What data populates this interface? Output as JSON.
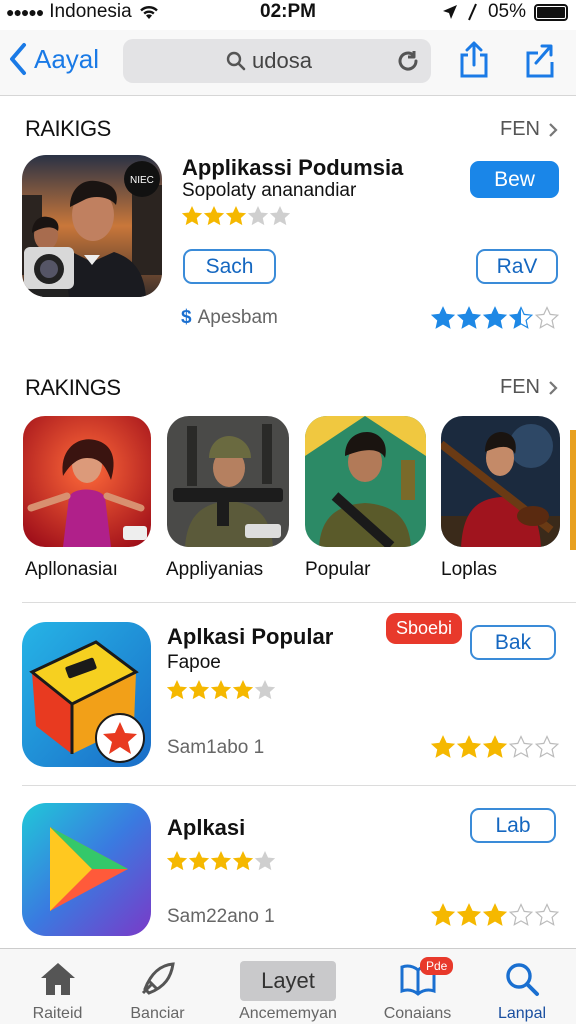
{
  "status": {
    "carrier": "Indonesia",
    "time": "02:PM",
    "battery": "05%"
  },
  "nav": {
    "back_label": "Aayal",
    "search_text": "udosa"
  },
  "section1": {
    "title": "RAIKIGS",
    "more": "FEN"
  },
  "featured": {
    "name": "Applikassi Podumsia",
    "subtitle": "Sopolaty ananandiar",
    "action_label": "Bew",
    "button_left": "Sach",
    "button_right": "RaV",
    "price_label": "Apesbam",
    "rating_small": 3,
    "rating_large": 3.5
  },
  "section2": {
    "title": "RAKINGS",
    "more": "FEN"
  },
  "grid": [
    {
      "label": "Apllonasiaı"
    },
    {
      "label": "Appliyanias"
    },
    {
      "label": "Popular"
    },
    {
      "label": "Loplas"
    }
  ],
  "list": [
    {
      "name": "Aplkasi Popular",
      "subtitle": "Fapoe",
      "badge": "Sboebi",
      "button": "Bak",
      "meta": "Sam1abo 1",
      "rating_small": 4,
      "rating_large": 3
    },
    {
      "name": "Aplkasi",
      "subtitle": "",
      "button": "Lab",
      "meta": "Sam22ano 1",
      "rating_small": 4,
      "rating_large": 3
    }
  ],
  "tabbar": {
    "tabs": [
      {
        "label": "Raiteid",
        "icon": "home-icon"
      },
      {
        "label": "Banciar",
        "icon": "rocket-icon"
      },
      {
        "label": "Ancememyan",
        "icon": "layet-badge",
        "text": "Layet"
      },
      {
        "label": "Conaians",
        "icon": "book-icon",
        "badge": "Pde"
      },
      {
        "label": "Lanpal",
        "icon": "search-icon"
      }
    ]
  },
  "colors": {
    "accent": "#1a86e8",
    "star_gold": "#f5b800",
    "star_blue": "#1e88e5",
    "badge_red": "#e8392b"
  }
}
